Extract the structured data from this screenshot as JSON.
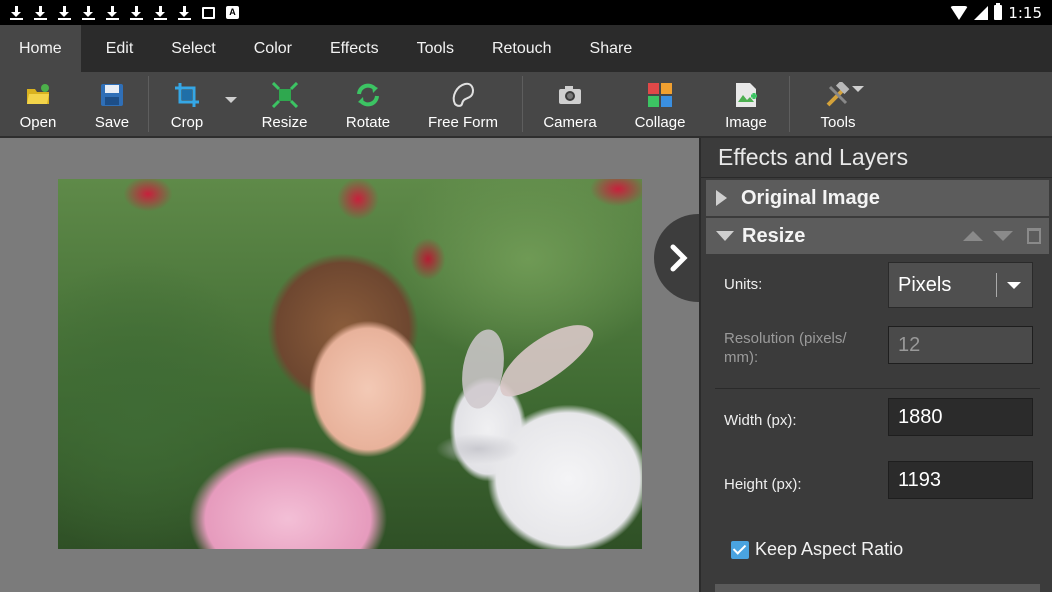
{
  "status_bar": {
    "time": "1:15"
  },
  "tabs": [
    {
      "label": "Home"
    },
    {
      "label": "Edit"
    },
    {
      "label": "Select"
    },
    {
      "label": "Color"
    },
    {
      "label": "Effects"
    },
    {
      "label": "Tools"
    },
    {
      "label": "Retouch"
    },
    {
      "label": "Share"
    }
  ],
  "toolbar": {
    "open": "Open",
    "save": "Save",
    "crop": "Crop",
    "resize": "Resize",
    "rotate": "Rotate",
    "free_form": "Free Form",
    "camera": "Camera",
    "collage": "Collage",
    "image": "Image",
    "tools": "Tools"
  },
  "panel": {
    "title": "Effects and Layers",
    "layer_original": "Original Image",
    "layer_resize": "Resize",
    "units_label": "Units:",
    "units_value": "Pixels",
    "resolution_label": "Resolution (pixels/ mm):",
    "resolution_value": "12",
    "width_label": "Width (px):",
    "width_value": "1880",
    "height_label": "Height (px):",
    "height_value": "1193",
    "keep_aspect_label": "Keep Aspect Ratio",
    "keep_aspect_checked": true
  },
  "colors": {
    "accent": "#4aa3df",
    "toolbar": "#474747",
    "tabbar": "#2b2b2b",
    "panel": "#3b3b3b"
  }
}
